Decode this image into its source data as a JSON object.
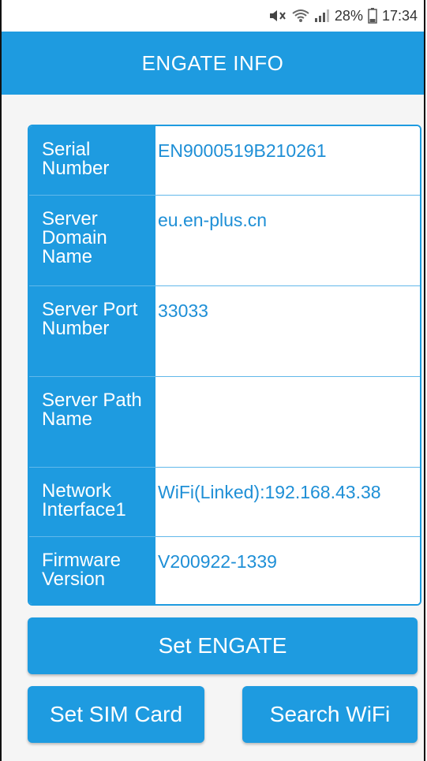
{
  "status_bar": {
    "battery_percent": "28%",
    "time": "17:34",
    "icons": [
      "mute-icon",
      "wifi-icon",
      "signal-icon",
      "battery-icon"
    ]
  },
  "app_bar": {
    "title": "ENGATE INFO"
  },
  "info_rows": [
    {
      "label": "Serial Number",
      "value": "EN9000519B210261"
    },
    {
      "label": "Server Domain Name",
      "value": "eu.en-plus.cn"
    },
    {
      "label": "Server Port Number",
      "value": "33033"
    },
    {
      "label": "Server Path Name",
      "value": ""
    },
    {
      "label": "Network Interface1",
      "value": "WiFi(Linked):192.168.43.38"
    },
    {
      "label": "Firmware Version",
      "value": "V200922-1339"
    }
  ],
  "buttons": {
    "set_engate": "Set ENGATE",
    "set_sim": "Set SIM Card",
    "search_wifi": "Search WiFi"
  },
  "colors": {
    "primary": "#1e9be0",
    "value_text": "#1e8fd6"
  }
}
